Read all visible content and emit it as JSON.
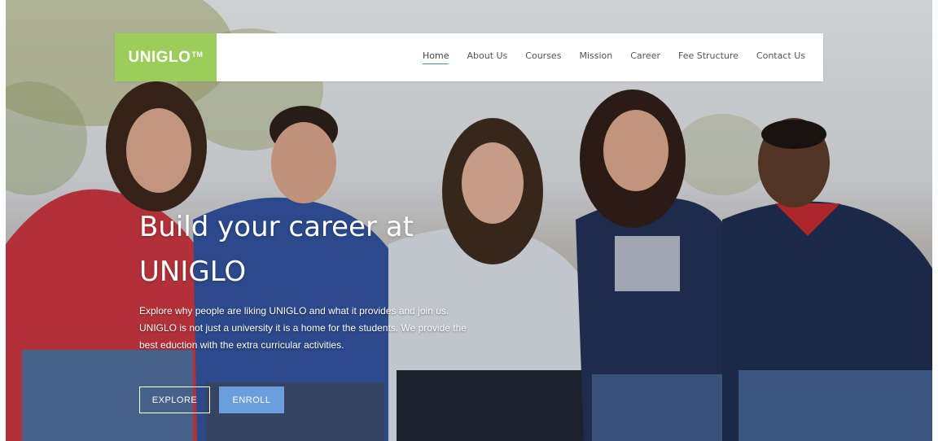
{
  "brand": {
    "name": "UNIGLO",
    "trademark": "TM",
    "color": "#9ccc5a"
  },
  "nav": {
    "items": [
      {
        "label": "Home",
        "active": true
      },
      {
        "label": "About Us"
      },
      {
        "label": "Courses"
      },
      {
        "label": "Mission"
      },
      {
        "label": "Career"
      },
      {
        "label": "Fee Structure"
      },
      {
        "label": "Contact Us"
      }
    ],
    "active_underline_color": "#4a90c2"
  },
  "hero": {
    "headline": "Build your career at UNIGLO",
    "description": "Explore why people are liking UNIGLO and what it provides and join us. UNIGLO is not just a university it is a home for the students. We provide the best eduction with the extra curricular activities.",
    "background": "photo of five smiling students sitting together",
    "buttons": {
      "explore_label": "EXPLORE",
      "enroll_label": "ENROLL",
      "enroll_color": "#6a9edc"
    }
  }
}
